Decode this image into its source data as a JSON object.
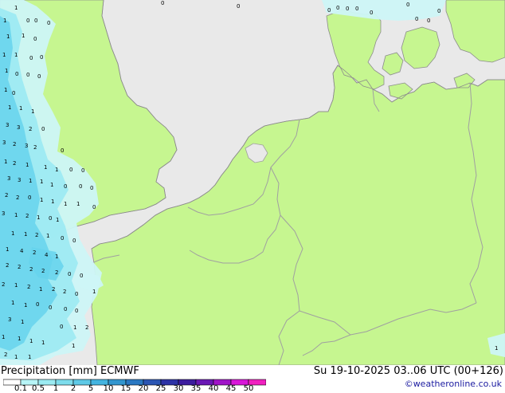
{
  "footer": {
    "title": "Precipitation [mm]  ECMWF",
    "valid_time": "Su 19-10-2025 03..06 UTC (00+126)",
    "credit": "©weatheronline.co.uk"
  },
  "legend": {
    "ticks": [
      "0.1",
      "0.5",
      "1",
      "2",
      "5",
      "10",
      "15",
      "20",
      "25",
      "30",
      "35",
      "40",
      "45",
      "50"
    ],
    "colors": [
      "#ffffff",
      "#b7f5f7",
      "#9bebf2",
      "#7ddcec",
      "#5ec9e6",
      "#43b4e0",
      "#3296cf",
      "#2a78c2",
      "#2b55b3",
      "#2d33a6",
      "#3c1c9e",
      "#6a18b4",
      "#a014c8",
      "#d816d8",
      "#f020c0"
    ]
  },
  "map": {
    "land_color": "#c6f690",
    "sea_color": "#e9e9e9",
    "border_color": "#a0a0a0",
    "precip_colors": {
      "light": "#cdf5f7",
      "medium": "#9beaf3",
      "heavy": "#66d4ec"
    },
    "values": [
      [
        "1",
        18,
        8
      ],
      [
        "0",
        33,
        24
      ],
      [
        "0",
        43,
        24
      ],
      [
        "0",
        59,
        27
      ],
      [
        "1",
        4,
        24
      ],
      [
        "0",
        297,
        6
      ],
      [
        "0",
        202,
        2
      ],
      [
        "0",
        411,
        11
      ],
      [
        "0",
        422,
        8
      ],
      [
        "0",
        434,
        9
      ],
      [
        "0",
        446,
        9
      ],
      [
        "0",
        464,
        14
      ],
      [
        "0",
        510,
        4
      ],
      [
        "0",
        521,
        22
      ],
      [
        "0",
        536,
        24
      ],
      [
        "0",
        549,
        12
      ],
      [
        "1",
        8,
        44
      ],
      [
        "1",
        27,
        43
      ],
      [
        "0",
        42,
        47
      ],
      [
        "1",
        3,
        67
      ],
      [
        "1",
        18,
        67
      ],
      [
        "0",
        37,
        71
      ],
      [
        "0",
        50,
        70
      ],
      [
        "1",
        6,
        87
      ],
      [
        "0",
        19,
        91
      ],
      [
        "0",
        33,
        92
      ],
      [
        "0",
        47,
        94
      ],
      [
        "1",
        5,
        111
      ],
      [
        "0",
        15,
        115
      ],
      [
        "1",
        10,
        133
      ],
      [
        "1",
        24,
        134
      ],
      [
        "1",
        39,
        138
      ],
      [
        "3",
        7,
        155
      ],
      [
        "3",
        21,
        158
      ],
      [
        "2",
        36,
        160
      ],
      [
        "0",
        52,
        160
      ],
      [
        "3",
        3,
        177
      ],
      [
        "2",
        16,
        179
      ],
      [
        "3",
        31,
        181
      ],
      [
        "2",
        42,
        183
      ],
      [
        "0",
        76,
        187
      ],
      [
        "1",
        5,
        201
      ],
      [
        "2",
        16,
        203
      ],
      [
        "1",
        32,
        205
      ],
      [
        "1",
        55,
        208
      ],
      [
        "1",
        69,
        211
      ],
      [
        "0",
        87,
        211
      ],
      [
        "0",
        102,
        212
      ],
      [
        "3",
        9,
        222
      ],
      [
        "3",
        22,
        224
      ],
      [
        "1",
        36,
        225
      ],
      [
        "1",
        50,
        226
      ],
      [
        "1",
        63,
        230
      ],
      [
        "0",
        80,
        232
      ],
      [
        "0",
        99,
        232
      ],
      [
        "0",
        113,
        234
      ],
      [
        "2",
        6,
        243
      ],
      [
        "2",
        20,
        246
      ],
      [
        "0",
        35,
        246
      ],
      [
        "1",
        50,
        249
      ],
      [
        "1",
        64,
        251
      ],
      [
        "1",
        80,
        254
      ],
      [
        "1",
        96,
        254
      ],
      [
        "0",
        116,
        258
      ],
      [
        "3",
        2,
        266
      ],
      [
        "1",
        18,
        268
      ],
      [
        "2",
        32,
        269
      ],
      [
        "1",
        46,
        271
      ],
      [
        "0",
        61,
        272
      ],
      [
        "1",
        70,
        274
      ],
      [
        "1",
        14,
        291
      ],
      [
        "1",
        30,
        292
      ],
      [
        "2",
        44,
        293
      ],
      [
        "1",
        58,
        294
      ],
      [
        "0",
        76,
        297
      ],
      [
        "0",
        91,
        300
      ],
      [
        "1",
        7,
        311
      ],
      [
        "4",
        25,
        313
      ],
      [
        "2",
        41,
        315
      ],
      [
        "4",
        56,
        318
      ],
      [
        "1",
        69,
        320
      ],
      [
        "2",
        7,
        331
      ],
      [
        "2",
        22,
        333
      ],
      [
        "2",
        37,
        336
      ],
      [
        "2",
        52,
        338
      ],
      [
        "2",
        69,
        340
      ],
      [
        "0",
        85,
        342
      ],
      [
        "0",
        100,
        344
      ],
      [
        "2",
        2,
        355
      ],
      [
        "1",
        18,
        356
      ],
      [
        "2",
        34,
        358
      ],
      [
        "1",
        49,
        361
      ],
      [
        "2",
        65,
        361
      ],
      [
        "2",
        79,
        364
      ],
      [
        "0",
        94,
        367
      ],
      [
        "1",
        116,
        364
      ],
      [
        "1",
        14,
        378
      ],
      [
        "1",
        30,
        381
      ],
      [
        "0",
        45,
        380
      ],
      [
        "0",
        61,
        384
      ],
      [
        "0",
        80,
        386
      ],
      [
        "0",
        94,
        388
      ],
      [
        "3",
        10,
        399
      ],
      [
        "1",
        26,
        402
      ],
      [
        "0",
        75,
        408
      ],
      [
        "1",
        92,
        409
      ],
      [
        "2",
        107,
        409
      ],
      [
        "1",
        2,
        421
      ],
      [
        "1",
        22,
        423
      ],
      [
        "1",
        37,
        426
      ],
      [
        "1",
        52,
        428
      ],
      [
        "1",
        90,
        432
      ],
      [
        "2",
        5,
        443
      ],
      [
        "1",
        18,
        446
      ],
      [
        "1",
        35,
        446
      ],
      [
        "1",
        621,
        435
      ]
    ]
  }
}
